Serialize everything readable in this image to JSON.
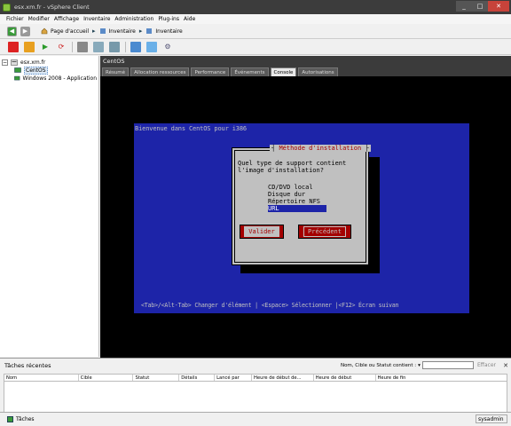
{
  "window": {
    "title": "esx.xm.fr - vSphere Client"
  },
  "menu": [
    "Fichier",
    "Modifier",
    "Affichage",
    "Inventaire",
    "Administration",
    "Plug-ins",
    "Aide"
  ],
  "breadcrumb": {
    "home": "Page d'accueil",
    "item1": "Inventaire",
    "item2": "Inventaire"
  },
  "tree": {
    "host": "esx.xm.fr",
    "vm1": "CentOS",
    "vm2": "Windows 2008 - Application"
  },
  "vm": {
    "name": "CentOS",
    "tabs": [
      "Résumé",
      "Allocation ressources",
      "Performance",
      "Événements",
      "Console",
      "Autorisations"
    ],
    "active_tab": "Console"
  },
  "console": {
    "welcome": "Bienvenue dans CentOS pour i386",
    "dialog_title": "Méthode d'installation",
    "question_line1": "Quel type de support contient",
    "question_line2": "l'image d'installation?",
    "options": [
      "CD/DVD local",
      "Disque dur",
      "Répertoire NFS",
      "URL"
    ],
    "selected_option": "URL",
    "btn_ok": "Valider",
    "btn_back": "Précédent",
    "help_line": "<Tab>/<Alt-Tab> Changer d'élément  | <Espace> Sélectionner |<F12> Écran suivan",
    "colors": {
      "background": "#1d24a8",
      "dialog": "#c0c0c0",
      "accent": "#a40000"
    }
  },
  "tasks": {
    "title": "Tâches récentes",
    "filter_label": "Nom, Cible ou Statut contient :",
    "filter_value": "",
    "clear": "Effacer",
    "columns": [
      "Nom",
      "Cible",
      "Statut",
      "Détails",
      "Lancé par",
      "Heure de début de...",
      "Heure de début",
      "Heure de fin"
    ]
  },
  "status": {
    "tasks_button": "Tâches",
    "user": "sysadmin"
  }
}
